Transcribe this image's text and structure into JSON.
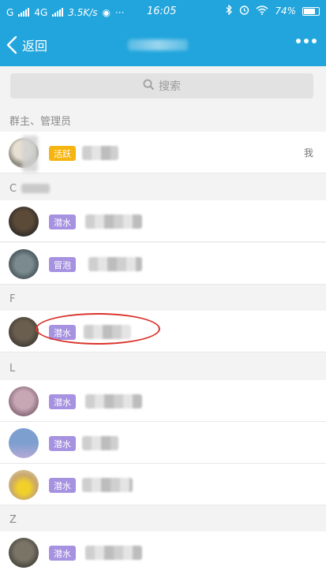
{
  "status_bar": {
    "carrier_1": "G",
    "carrier_2": "4G",
    "speed": "3.5K/s",
    "more_dots": "···",
    "time": "16:05",
    "battery_percent": "74%"
  },
  "title_bar": {
    "back_label": "返回"
  },
  "search": {
    "placeholder": "搜索"
  },
  "sections": [
    {
      "label": "群主、管理员"
    },
    {
      "label": "C"
    },
    {
      "label": "F"
    },
    {
      "label": "L"
    },
    {
      "label": "Z"
    }
  ],
  "members": [
    {
      "badge": "活跃",
      "badge_color": "#f5b511",
      "me_label": "我"
    },
    {
      "badge": "潜水",
      "badge_color": "#a692e0"
    },
    {
      "badge": "冒泡",
      "badge_color": "#a692e0"
    },
    {
      "badge": "潜水",
      "badge_color": "#a692e0"
    },
    {
      "badge": "潜水",
      "badge_color": "#a692e0"
    },
    {
      "badge": "潜水",
      "badge_color": "#a692e0"
    },
    {
      "badge": "潜水",
      "badge_color": "#a692e0"
    },
    {
      "badge": "潜水",
      "badge_color": "#a692e0"
    }
  ],
  "colors": {
    "header_bg": "#21a5dc",
    "annotation": "#d9342b"
  }
}
